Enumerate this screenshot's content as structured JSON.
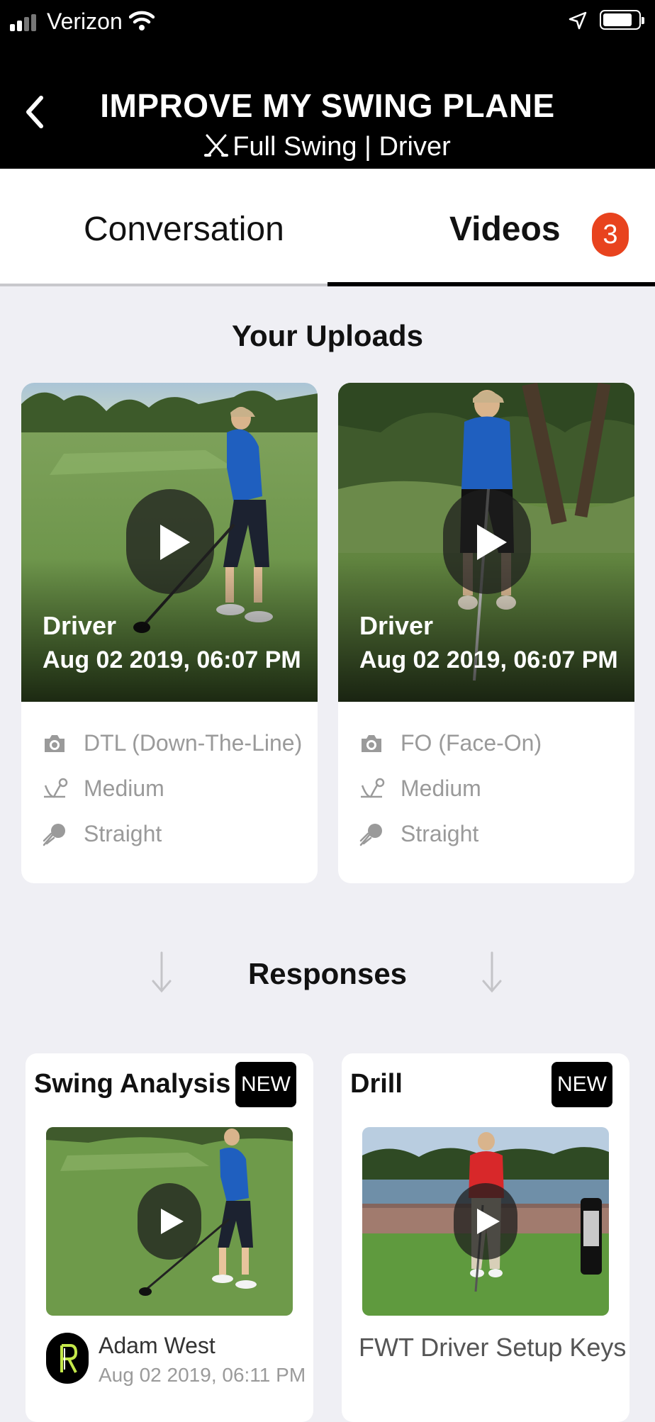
{
  "status_bar": {
    "carrier": "Verizon"
  },
  "header": {
    "title": "IMPROVE MY SWING PLANE",
    "subtitle": "Full Swing | Driver"
  },
  "tabs": [
    {
      "label": "Conversation",
      "active": false
    },
    {
      "label": "Videos",
      "active": true,
      "badge": "3"
    }
  ],
  "uploads": {
    "heading": "Your Uploads",
    "items": [
      {
        "club": "Driver",
        "date": "Aug 02 2019, 06:07 PM",
        "camera": "DTL (Down-The-Line)",
        "trajectory": "Medium",
        "shape": "Straight"
      },
      {
        "club": "Driver",
        "date": "Aug 02 2019, 06:07 PM",
        "camera": "FO (Face-On)",
        "trajectory": "Medium",
        "shape": "Straight"
      }
    ]
  },
  "responses": {
    "heading": "Responses",
    "items": [
      {
        "type": "Swing Analysis",
        "badge": "NEW",
        "author": "Adam West",
        "date": "Aug 02 2019, 06:11 PM"
      },
      {
        "type": "Drill",
        "badge": "NEW",
        "title": "FWT Driver Setup Keys"
      }
    ]
  },
  "colors": {
    "accent": "#e8431e",
    "header_bg": "#000000",
    "page_bg": "#efeff4"
  }
}
